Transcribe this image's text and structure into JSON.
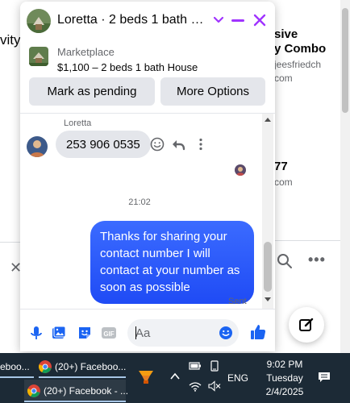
{
  "background_page": {
    "left_text": "vity",
    "right_title_line1": "sive",
    "right_title_line2": "y Combo",
    "right_sub_line1": "jeesfriedch",
    "right_sub_line2": "com",
    "right_number": "77",
    "right_sub_line3": "com",
    "icons": [
      "search-icon",
      "more-horizontal-icon",
      "close-icon",
      "compose-icon"
    ]
  },
  "chat": {
    "header": {
      "title": "Loretta · 2 beds 1 bath Hou...",
      "accent_color": "#a033ff"
    },
    "listing": {
      "source": "Marketplace",
      "description": "$1,100 – 2 beds 1 bath House"
    },
    "actions": {
      "mark_pending": "Mark as pending",
      "more_options": "More Options"
    },
    "messages": {
      "sender_name": "Loretta",
      "incoming_text": "253 906 0535",
      "timestamp": "21:02",
      "outgoing_text": "Thanks for sharing your contact number I will contact at your number as soon as possible",
      "status": "Sent",
      "outgoing_color": "#2d5bff"
    },
    "composer": {
      "placeholder": "Aa"
    }
  },
  "taskbar": {
    "item1_label": "eboo...",
    "item2_label": "(20+) Faceboo...",
    "item3_label": "(20+) Facebook - ...",
    "language": "ENG",
    "time": "9:02 PM",
    "day": "Tuesday",
    "date": "2/4/2025"
  }
}
